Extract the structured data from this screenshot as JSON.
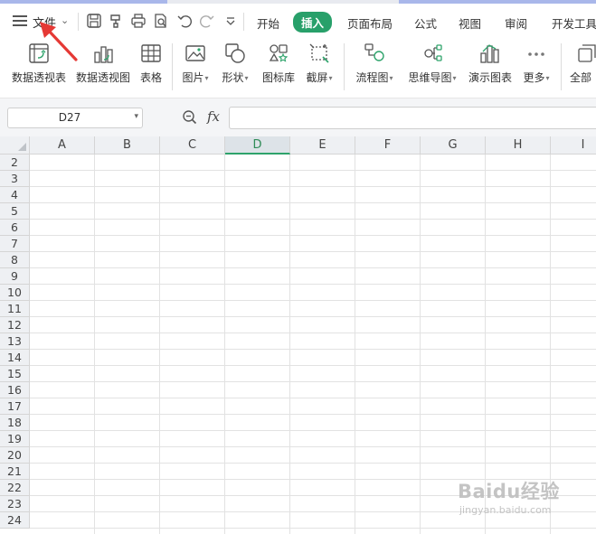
{
  "menu": {
    "file_label": "文件",
    "tabs": [
      "开始",
      "插入",
      "页面布局",
      "公式",
      "视图",
      "审阅",
      "开发工具"
    ],
    "active_tab": "插入"
  },
  "ribbon": {
    "items": [
      {
        "label": "数据透视表",
        "icon": "pivot-table-icon",
        "dropdown": false
      },
      {
        "label": "数据透视图",
        "icon": "pivot-chart-icon",
        "dropdown": false
      },
      {
        "label": "表格",
        "icon": "table-icon",
        "dropdown": false
      },
      {
        "label": "图片",
        "icon": "picture-icon",
        "dropdown": true
      },
      {
        "label": "形状",
        "icon": "shape-icon",
        "dropdown": true
      },
      {
        "label": "图标库",
        "icon": "icon-library-icon",
        "dropdown": false
      },
      {
        "label": "截屏",
        "icon": "screenshot-icon",
        "dropdown": true
      },
      {
        "label": "流程图",
        "icon": "flowchart-icon",
        "dropdown": true
      },
      {
        "label": "思维导图",
        "icon": "mindmap-icon",
        "dropdown": true
      },
      {
        "label": "演示图表",
        "icon": "demo-chart-icon",
        "dropdown": false
      },
      {
        "label": "更多",
        "icon": "more-icon",
        "dropdown": true
      },
      {
        "label": "全部",
        "icon": "all-icon",
        "dropdown": false
      }
    ]
  },
  "formula_bar": {
    "name_box": "D27",
    "fx_label": "fx",
    "formula": ""
  },
  "sheet": {
    "columns": [
      "A",
      "B",
      "C",
      "D",
      "E",
      "F",
      "G",
      "H",
      "I"
    ],
    "selected_column": "D",
    "rows": [
      "2",
      "3",
      "4",
      "5",
      "6",
      "7",
      "8",
      "9",
      "10",
      "11",
      "12",
      "13",
      "14",
      "15",
      "16",
      "17",
      "18",
      "19",
      "20",
      "21",
      "22",
      "23",
      "24"
    ]
  },
  "watermark": {
    "brand": "Baidu经验",
    "url": "jingyan.baidu.com"
  },
  "colors": {
    "accent": "#28a06a",
    "annotation_arrow": "#e53935"
  }
}
